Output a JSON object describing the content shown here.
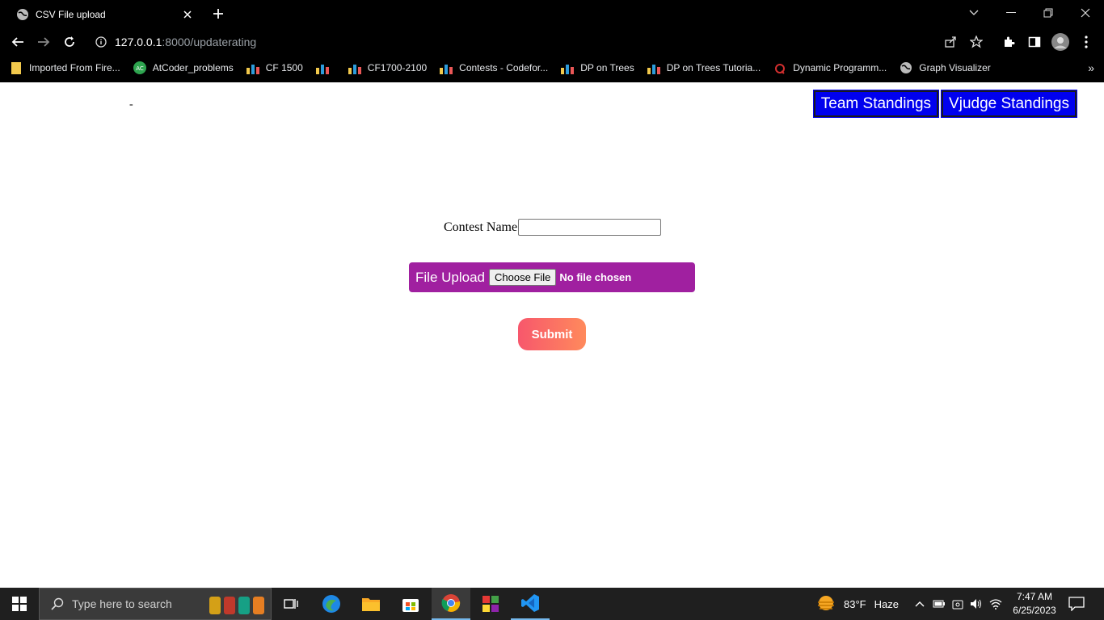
{
  "browser": {
    "tab_title": "CSV File upload",
    "url_host": "127.0.0.1",
    "url_path": ":8000/updaterating",
    "bookmarks": [
      {
        "label": "Imported From Fire...",
        "icon": "folder-icon"
      },
      {
        "label": "AtCoder_problems",
        "icon": "atcoder-icon"
      },
      {
        "label": "CF 1500",
        "icon": "codeforces-icon"
      },
      {
        "label": "",
        "icon": "codeforces-icon"
      },
      {
        "label": "CF1700-2100",
        "icon": "codeforces-icon"
      },
      {
        "label": "Contests - Codefor...",
        "icon": "codeforces-icon"
      },
      {
        "label": "DP on Trees",
        "icon": "codeforces-icon"
      },
      {
        "label": "DP on Trees Tutoria...",
        "icon": "codeforces-icon"
      },
      {
        "label": "Dynamic Programm...",
        "icon": "quora-icon"
      },
      {
        "label": "Graph Visualizer",
        "icon": "globe-icon"
      }
    ],
    "bookmarks_more": "»"
  },
  "page": {
    "dash": "-",
    "team_standings": "Team Standings",
    "vjudge_standings": "Vjudge Standings",
    "contest_name_label": "Contest Name",
    "contest_name_value": "",
    "file_upload_label": "File Upload",
    "choose_file_label": "Choose File",
    "no_file_text": "No file chosen",
    "submit_label": "Submit"
  },
  "taskbar": {
    "search_placeholder": "Type here to search",
    "weather_temp": "83°F",
    "weather_desc": "Haze",
    "time": "7:47 AM",
    "date": "6/25/2023"
  },
  "colors": {
    "standings_bg": "#0000ee",
    "upload_bg": "#a020a0",
    "submit_gradient_start": "#f7576c",
    "submit_gradient_end": "#ff8a5c"
  }
}
